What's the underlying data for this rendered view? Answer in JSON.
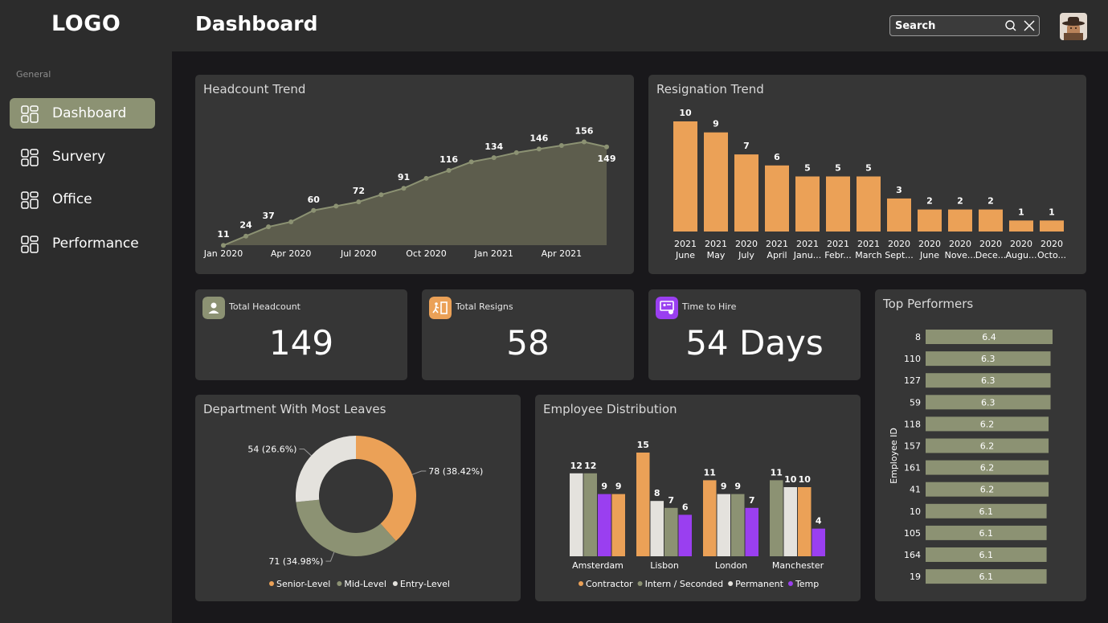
{
  "app": {
    "logo": "LOGO",
    "title": "Dashboard"
  },
  "search": {
    "placeholder": "Search"
  },
  "sidebar": {
    "section": "General",
    "items": [
      {
        "label": "Dashboard",
        "active": true
      },
      {
        "label": "Survery",
        "active": false
      },
      {
        "label": "Office",
        "active": false
      },
      {
        "label": "Performance",
        "active": false
      }
    ]
  },
  "colors": {
    "olive": "#8c9273",
    "orange": "#eba157",
    "white": "#e4e2dd",
    "purple": "#9a3ff0",
    "card": "#363636"
  },
  "headcount": {
    "title": "Headcount Trend",
    "chart_data": {
      "type": "area",
      "title": "Headcount Trend",
      "x": [
        "2020-01",
        "2020-02",
        "2020-03",
        "2020-04",
        "2020-05",
        "2020-06",
        "2020-07",
        "2020-08",
        "2020-09",
        "2020-10",
        "2020-11",
        "2020-12",
        "2021-01",
        "2021-02",
        "2021-03",
        "2021-04",
        "2021-05",
        "2021-06"
      ],
      "values": [
        11,
        24,
        37,
        44,
        60,
        66,
        72,
        82,
        91,
        105,
        116,
        128,
        134,
        141,
        146,
        151,
        156,
        149
      ],
      "labeled_points": [
        {
          "index": 0,
          "text": "11"
        },
        {
          "index": 1,
          "text": "24"
        },
        {
          "index": 2,
          "text": "37"
        },
        {
          "index": 4,
          "text": "60"
        },
        {
          "index": 6,
          "text": "72"
        },
        {
          "index": 8,
          "text": "91"
        },
        {
          "index": 10,
          "text": "116"
        },
        {
          "index": 12,
          "text": "134"
        },
        {
          "index": 14,
          "text": "146"
        },
        {
          "index": 16,
          "text": "156"
        },
        {
          "index": 17,
          "text": "149"
        }
      ],
      "tick_labels": [
        {
          "index": 0,
          "text": "Jan 2020"
        },
        {
          "index": 3,
          "text": "Apr 2020"
        },
        {
          "index": 6,
          "text": "Jul 2020"
        },
        {
          "index": 9,
          "text": "Oct 2020"
        },
        {
          "index": 12,
          "text": "Jan 2021"
        },
        {
          "index": 15,
          "text": "Apr 2021"
        }
      ]
    }
  },
  "resignation": {
    "title": "Resignation Trend",
    "chart_data": {
      "type": "bar",
      "title": "Resignation Trend",
      "categories": [
        [
          "2021",
          "June"
        ],
        [
          "2021",
          "May"
        ],
        [
          "2020",
          "July"
        ],
        [
          "2021",
          "April"
        ],
        [
          "2021",
          "Janu..."
        ],
        [
          "2021",
          "Febr..."
        ],
        [
          "2021",
          "March"
        ],
        [
          "2020",
          "Sept..."
        ],
        [
          "2020",
          "June"
        ],
        [
          "2020",
          "Nove..."
        ],
        [
          "2020",
          "Dece..."
        ],
        [
          "2020",
          "Augu..."
        ],
        [
          "2020",
          "Octo..."
        ]
      ],
      "values": [
        10,
        9,
        7,
        6,
        5,
        5,
        5,
        3,
        2,
        2,
        2,
        1,
        1
      ]
    }
  },
  "kpis": [
    {
      "label": "Total Headcount",
      "value": "149"
    },
    {
      "label": "Total Resigns",
      "value": "58"
    },
    {
      "label": "Time to Hire",
      "value": "54 Days"
    }
  ],
  "leaves": {
    "title": "Department With Most Leaves",
    "chart_data": {
      "type": "pie",
      "title": "Department With Most Leaves",
      "slices": [
        {
          "name": "Senior-Level",
          "value": 78,
          "label": "78 (38.42%)",
          "color": "#eba157"
        },
        {
          "name": "Mid-Level",
          "value": 71,
          "label": "71 (34.98%)",
          "color": "#8c9273"
        },
        {
          "name": "Entry-Level",
          "value": 54,
          "label": "54 (26.6%)",
          "color": "#e4e2dd"
        }
      ]
    }
  },
  "distribution": {
    "title": "Employee Distribution",
    "chart_data": {
      "type": "bar",
      "title": "Employee Distribution",
      "categories": [
        "Amsterdam",
        "Lisbon",
        "London",
        "Manchester"
      ],
      "series": [
        {
          "name": "Entry-Level",
          "color": "#e4e2dd",
          "values": [
            12,
            8,
            9,
            10
          ]
        },
        {
          "name": "Mid-Level",
          "color": "#8c9273",
          "values": [
            12,
            7,
            9,
            11
          ]
        },
        {
          "name": "Temp",
          "color": "#9a3ff0",
          "values": [
            9,
            6,
            7,
            4
          ]
        },
        {
          "name": "Contractor",
          "color": "#eba157",
          "values": [
            9,
            15,
            11,
            10
          ]
        }
      ],
      "per_city_order": [
        [
          "Entry-Level",
          "Mid-Level",
          "Temp",
          "Contractor"
        ],
        [
          "Contractor",
          "Entry-Level",
          "Mid-Level",
          "Temp"
        ],
        [
          "Contractor",
          "Entry-Level",
          "Mid-Level",
          "Temp"
        ],
        [
          "Mid-Level",
          "Entry-Level",
          "Contractor",
          "Temp"
        ]
      ],
      "legend": [
        {
          "name": "Contractor",
          "color": "#eba157"
        },
        {
          "name": "Intern / Seconded",
          "color": "#8c9273"
        },
        {
          "name": "Permanent",
          "color": "#e4e2dd"
        },
        {
          "name": "Temp",
          "color": "#9a3ff0"
        }
      ]
    }
  },
  "performers": {
    "title": "Top Performers",
    "chart_data": {
      "type": "bar",
      "orientation": "horizontal",
      "title": "Top Performers",
      "ylabel": "Employee ID",
      "categories": [
        "8",
        "110",
        "127",
        "59",
        "118",
        "157",
        "161",
        "41",
        "10",
        "105",
        "164",
        "19"
      ],
      "values": [
        6.4,
        6.3,
        6.3,
        6.3,
        6.2,
        6.2,
        6.2,
        6.2,
        6.1,
        6.1,
        6.1,
        6.1
      ]
    }
  }
}
